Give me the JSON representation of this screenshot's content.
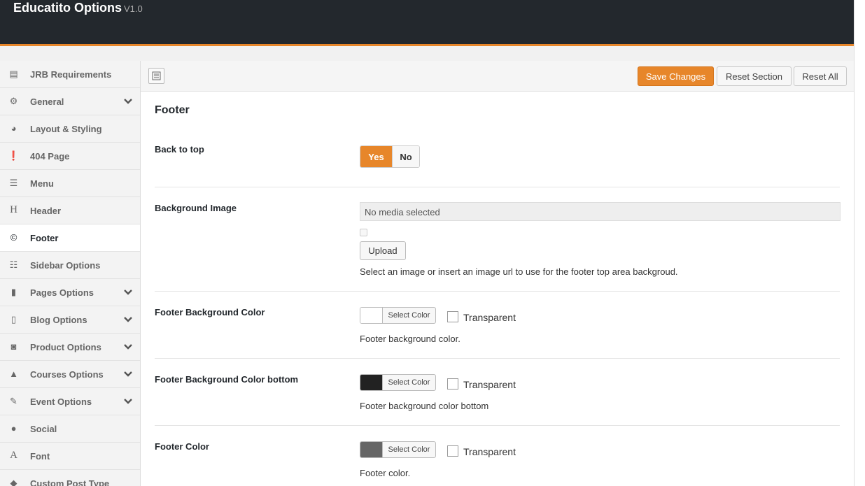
{
  "app": {
    "title": "Educatito Options",
    "version": "V1.0"
  },
  "sidebar": {
    "items": [
      {
        "label": "JRB Requirements",
        "icon": "list-icon",
        "glyph": "▤",
        "has_chevron": false
      },
      {
        "label": "General",
        "icon": "cogs-icon",
        "glyph": "⚙",
        "has_chevron": true
      },
      {
        "label": "Layout & Styling",
        "icon": "palette-icon",
        "glyph": "◕",
        "has_chevron": false
      },
      {
        "label": "404 Page",
        "icon": "exclamation-circle-icon",
        "glyph": "❗",
        "has_chevron": false
      },
      {
        "label": "Menu",
        "icon": "menu-icon",
        "glyph": "☰",
        "has_chevron": false
      },
      {
        "label": "Header",
        "icon": "header-icon",
        "glyph": "H",
        "has_chevron": false
      },
      {
        "label": "Footer",
        "icon": "copyright-icon",
        "glyph": "©",
        "has_chevron": false,
        "active": true
      },
      {
        "label": "Sidebar Options",
        "icon": "th-list-icon",
        "glyph": "☷",
        "has_chevron": false
      },
      {
        "label": "Pages Options",
        "icon": "file-icon",
        "glyph": "▮",
        "has_chevron": true
      },
      {
        "label": "Blog Options",
        "icon": "file-text-icon",
        "glyph": "▯",
        "has_chevron": true
      },
      {
        "label": "Product Options",
        "icon": "shopping-bag-icon",
        "glyph": "◙",
        "has_chevron": true
      },
      {
        "label": "Courses Options",
        "icon": "graduation-cap-icon",
        "glyph": "▲",
        "has_chevron": true
      },
      {
        "label": "Event Options",
        "icon": "edit-icon",
        "glyph": "✎",
        "has_chevron": true
      },
      {
        "label": "Social",
        "icon": "globe-icon",
        "glyph": "●",
        "has_chevron": false
      },
      {
        "label": "Font",
        "icon": "font-icon",
        "glyph": "A",
        "has_chevron": false
      },
      {
        "label": "Custom Post Type",
        "icon": "tags-icon",
        "glyph": "◆",
        "has_chevron": false
      }
    ]
  },
  "toolbar": {
    "save_label": "Save Changes",
    "reset_section_label": "Reset Section",
    "reset_all_label": "Reset All"
  },
  "section": {
    "title": "Footer",
    "back_to_top": {
      "label": "Back to top",
      "yes_label": "Yes",
      "no_label": "No",
      "value": "Yes"
    },
    "background_image": {
      "label": "Background Image",
      "value": "No media selected",
      "upload_label": "Upload",
      "description": "Select an image or insert an image url to use for the footer top area backgroud."
    },
    "bg_color": {
      "label": "Footer Background Color",
      "select_label": "Select Color",
      "transparent_label": "Transparent",
      "description": "Footer background color.",
      "color": "#ffffff"
    },
    "bg_color_bottom": {
      "label": "Footer Background Color bottom",
      "select_label": "Select Color",
      "transparent_label": "Transparent",
      "description": "Footer background color bottom",
      "color": "#222222"
    },
    "footer_color": {
      "label": "Footer Color",
      "select_label": "Select Color",
      "transparent_label": "Transparent",
      "description": "Footer color.",
      "color": "#666666"
    }
  },
  "colors": {
    "accent": "#e7862a",
    "topbar": "#23282d"
  }
}
